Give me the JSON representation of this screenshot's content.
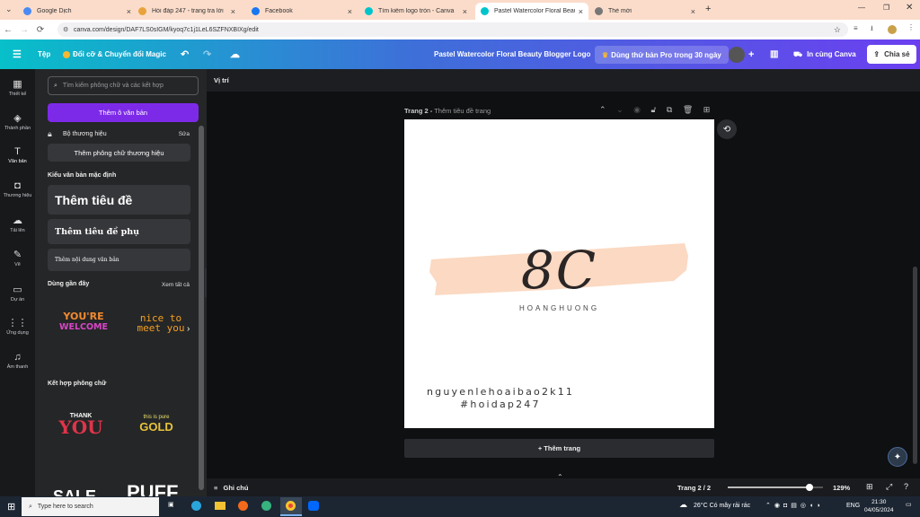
{
  "browser": {
    "tabs": [
      {
        "label": "Google Dịch",
        "close": "×",
        "color": "#4a8af4"
      },
      {
        "label": "Hỏi đáp 247 - trang tra lời",
        "close": "×",
        "color": "#e8a33c"
      },
      {
        "label": "Facebook",
        "close": "×",
        "color": "#1877f2"
      },
      {
        "label": "Tìm kiếm logo tròn - Canva",
        "close": "×",
        "color": "#00c4cc"
      },
      {
        "label": "Pastel Watercolor Floral Beauty",
        "close": "×",
        "color": "#00c4cc"
      },
      {
        "label": "Thẻ mới",
        "close": "×",
        "color": "#777"
      }
    ],
    "new_tab": "+",
    "url": "canva.com/design/DAF7LS0sIGM/kyoq7c1j1LeL6SZFNXBIXg/edit"
  },
  "canva_header": {
    "menu_icon": "☰",
    "file": "Tệp",
    "magic": "Đổi cỡ & Chuyển đổi Magic",
    "title": "Pastel Watercolor Floral Beauty Blogger Logo",
    "pro": "Dùng thử bản Pro trong 30 ngày",
    "print": "In cùng Canva",
    "share": "Chia sẻ"
  },
  "rail": [
    {
      "label": "Thiết kế",
      "icon": "▦"
    },
    {
      "label": "Thành phần",
      "icon": "◈"
    },
    {
      "label": "Văn bản",
      "icon": "T"
    },
    {
      "label": "Thương hiệu",
      "icon": "◘"
    },
    {
      "label": "Tải lên",
      "icon": "☁"
    },
    {
      "label": "Vẽ",
      "icon": "✎"
    },
    {
      "label": "Dự án",
      "icon": "▭"
    },
    {
      "label": "Ứng dụng",
      "icon": "⋮⋮"
    },
    {
      "label": "Âm thanh",
      "icon": "♫"
    }
  ],
  "panel": {
    "search_placeholder": "Tìm kiếm phông chữ và các kết hợp",
    "add_box": "Thêm ô văn bản",
    "brand_kit": "Bộ thương hiệu",
    "brand_edit": "Sửa",
    "brand_fonts": "Thêm phông chữ thương hiệu",
    "default_styles": "Kiểu văn bản mặc định",
    "heading": "Thêm tiêu đề",
    "subheading": "Thêm tiêu đề phụ",
    "body": "Thêm nội dung văn bản",
    "recent": "Dùng gần đây",
    "see_all": "Xem tất cả",
    "recent_1a": "YOU'RE",
    "recent_1b": "WELCOME",
    "recent_2a": "nice to",
    "recent_2b": "meet you",
    "combos": "Kết hợp phông chữ",
    "combo_1a": "THANK",
    "combo_1b": "YOU",
    "combo_2a": "this is pure",
    "combo_2b": "GOLD",
    "combo_3": "SALE",
    "combo_4": "PUFF"
  },
  "workspace": {
    "position": "Vị trí",
    "page_label": "Trang 2 -",
    "page_title_placeholder": "Thêm tiêu đề trang",
    "logo_text": "8C",
    "logo_sub": "HOANGHUONG",
    "line1": "nguyenlehoaibao2k11",
    "line2": "#hoidap247",
    "add_page": "+ Thêm trang",
    "swatch": "#fbd9c2"
  },
  "footer": {
    "notes": "Ghi chú",
    "page_count": "Trang 2 / 2",
    "zoom": "129%",
    "zoom_level": 0.86
  },
  "taskbar": {
    "search": "Type here to search",
    "weather": "26°C  Có mây rải rác",
    "lang": "ENG",
    "time": "21:30",
    "date": "04/05/2024"
  }
}
